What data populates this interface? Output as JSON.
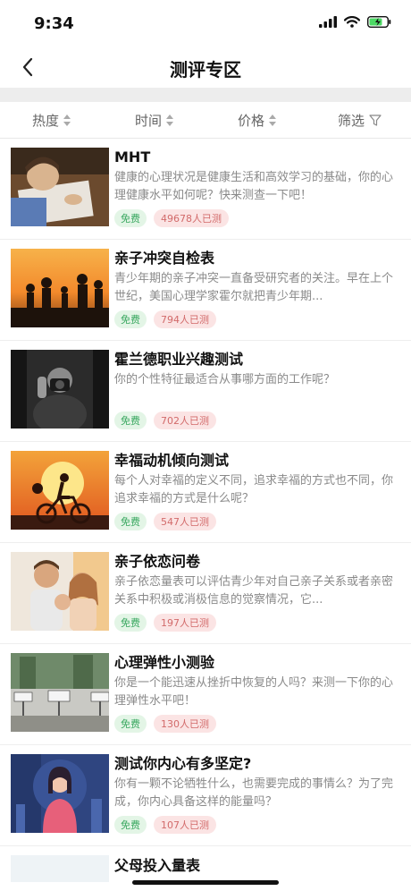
{
  "status_bar": {
    "time": "9:34"
  },
  "header": {
    "title": "测评专区"
  },
  "filters": [
    {
      "label": "热度"
    },
    {
      "label": "时间"
    },
    {
      "label": "价格"
    },
    {
      "label": "筛选"
    }
  ],
  "items": [
    {
      "title": "MHT",
      "desc": "健康的心理状况是健康生活和高效学习的基础，你的心理健康水平如何呢？快来测查一下吧！",
      "free": "免费",
      "count": "49678人已测",
      "image": "child-writing-photo"
    },
    {
      "title": "亲子冲突自检表",
      "desc": "青少年期的亲子冲突一直备受研究者的关注。早在上个世纪，美国心理学家霍尔就把青少年期...",
      "free": "免费",
      "count": "794人已测",
      "image": "sunset-silhouette-photo"
    },
    {
      "title": "霍兰德职业兴趣测试",
      "desc": "你的个性特征最适合从事哪方面的工作呢？",
      "free": "免费",
      "count": "702人已测",
      "image": "photographer-photo"
    },
    {
      "title": "幸福动机倾向测试",
      "desc": "每个人对幸福的定义不同，追求幸福的方式也不同，你追求幸福的方式是什么呢？",
      "free": "免费",
      "count": "547人已测",
      "image": "cycling-sunset-photo"
    },
    {
      "title": "亲子依恋问卷",
      "desc": "亲子依恋量表可以评估青少年对自己亲子关系或者亲密关系中积极或消极信息的觉察情况，它...",
      "free": "免费",
      "count": "197人已测",
      "image": "family-photo"
    },
    {
      "title": "心理弹性小测验",
      "desc": "你是一个能迅速从挫折中恢复的人吗？来测一下你的心理弹性水平吧！",
      "free": "免费",
      "count": "130人已测",
      "image": "street-signs-photo"
    },
    {
      "title": "测试你内心有多坚定?",
      "desc": "你有一颗不论牺牲什么，也需要完成的事情么？为了完成，你内心具备这样的能量吗？",
      "free": "免费",
      "count": "107人已测",
      "image": "woman-illustration"
    }
  ],
  "partial_item": {
    "title": "父母投入量表"
  }
}
